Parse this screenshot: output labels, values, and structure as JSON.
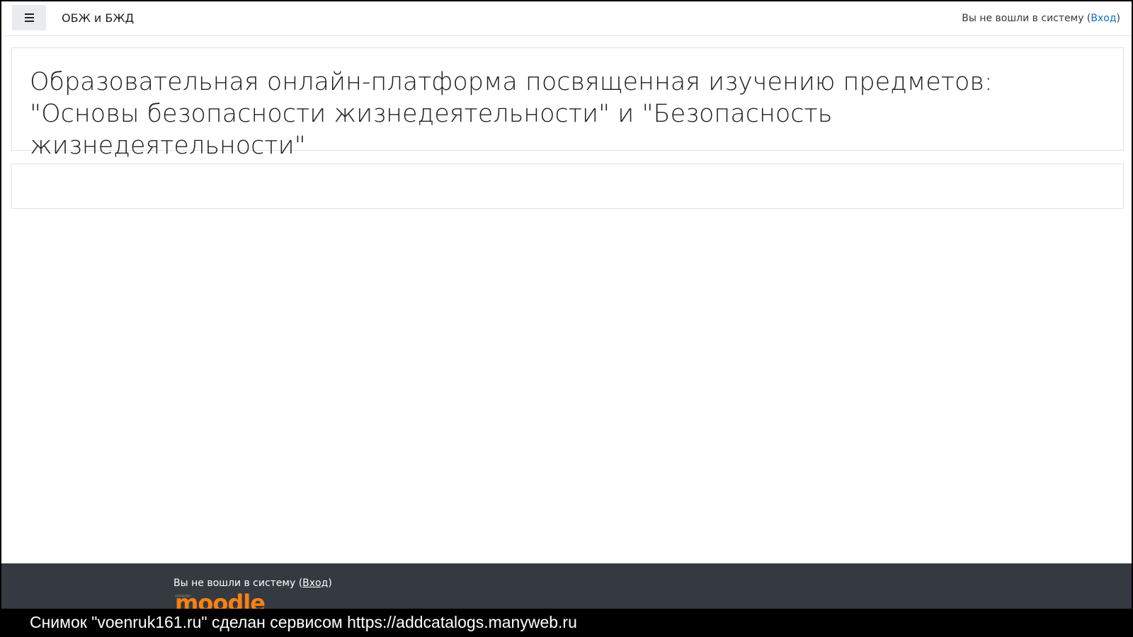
{
  "navbar": {
    "menu_icon": "hamburger-menu-icon",
    "site_name": "ОБЖ и БЖД",
    "login_text": "Вы не вошли в систему (",
    "login_link": "Вход",
    "login_close": ")"
  },
  "header": {
    "title": "Образовательная онлайн-платформа посвященная изучению предметов: \"Основы безопасности жизнедеятельности\" и \"Безопасность жизнедеятельности\""
  },
  "footer": {
    "login_text": "Вы не вошли в систему (",
    "login_link": "Вход",
    "login_close": ")",
    "logo_text": "moodle"
  },
  "caption": {
    "text": "Снимок \"voenruk161.ru\" сделан сервисом https://addcatalogs.manyweb.ru"
  },
  "colors": {
    "footer_bg": "#343a40",
    "link": "#0f6cbf",
    "moodle_orange": "#f98012"
  }
}
